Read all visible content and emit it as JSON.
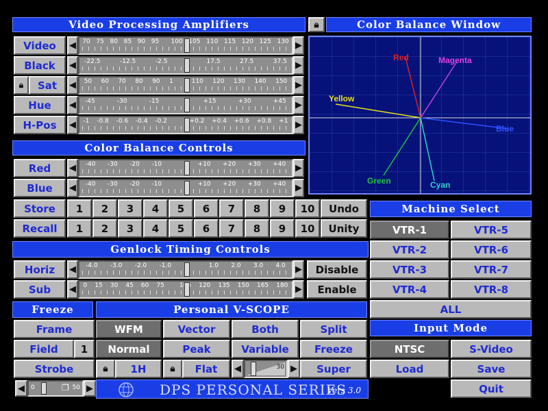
{
  "vpa": {
    "title": "Video Processing Amplifiers",
    "rows": [
      {
        "label": "Video",
        "ticks": [
          "70",
          "75",
          "80",
          "85",
          "90",
          "95",
          "",
          "100",
          "105",
          "110",
          "115",
          "120",
          "125",
          "130"
        ]
      },
      {
        "label": "Black",
        "ticks": [
          "-22.5",
          "",
          "-12.5",
          "",
          "-2.5",
          "",
          "",
          "",
          "17.5",
          "",
          "27.5",
          "",
          "37.5"
        ]
      },
      {
        "label": "Sat",
        "ticks": [
          "50",
          "60",
          "70",
          "80",
          "90",
          "1",
          "",
          "110",
          "120",
          "130",
          "140",
          "150"
        ]
      },
      {
        "label": "Hue",
        "ticks": [
          "-45",
          "",
          "-30",
          "",
          "-15",
          "",
          "",
          "",
          "+15",
          "",
          "+30",
          "",
          "+45"
        ]
      },
      {
        "label": "H-Pos",
        "ticks": [
          "-1",
          "-0.8",
          "-0.6",
          "-0.4",
          "-0.2",
          "",
          "",
          "+0.2",
          "+0.4",
          "+0.6",
          "+0.8",
          "+1"
        ]
      }
    ]
  },
  "cb_window": {
    "title": "Color Balance Window",
    "vectors": [
      {
        "name": "Red",
        "color": "#e02020"
      },
      {
        "name": "Magenta",
        "color": "#e040e0"
      },
      {
        "name": "Yellow",
        "color": "#e8e020"
      },
      {
        "name": "Blue",
        "color": "#3050ff"
      },
      {
        "name": "Green",
        "color": "#20c040"
      },
      {
        "name": "Cyan",
        "color": "#30d0d0"
      }
    ]
  },
  "cbc": {
    "title": "Color Balance Controls",
    "rows": [
      {
        "label": "Red",
        "ticks": [
          "-40",
          "-30",
          "-20",
          "-10",
          "",
          "",
          "+10",
          "+20",
          "+30",
          "+40"
        ]
      },
      {
        "label": "Blue",
        "ticks": [
          "-40",
          "-30",
          "-20",
          "-10",
          "",
          "",
          "+10",
          "+20",
          "+30",
          "+40"
        ]
      }
    ]
  },
  "store": {
    "label": "Store",
    "numbers": [
      "1",
      "2",
      "3",
      "4",
      "5",
      "6",
      "7",
      "8",
      "9",
      "10"
    ],
    "extra": "Undo"
  },
  "recall": {
    "label": "Recall",
    "numbers": [
      "1",
      "2",
      "3",
      "4",
      "5",
      "6",
      "7",
      "8",
      "9",
      "10"
    ],
    "extra": "Unity"
  },
  "machine": {
    "title": "Machine Select",
    "items": [
      "VTR-1",
      "VTR-5",
      "VTR-2",
      "VTR-6",
      "VTR-3",
      "VTR-7",
      "VTR-4",
      "VTR-8"
    ],
    "all": "ALL"
  },
  "genlock": {
    "title": "Genlock Timing Controls",
    "rows": [
      {
        "label": "Horiz",
        "ticks": [
          "-4.0",
          "-3.0",
          "-2.0",
          "-1.0",
          "",
          "",
          "1.0",
          "2.0",
          "3.0",
          "4.0"
        ],
        "action": "Disable"
      },
      {
        "label": "Sub",
        "ticks": [
          "0",
          "15",
          "30",
          "45",
          "60",
          "75",
          "",
          "105",
          "120",
          "135",
          "150",
          "165",
          "180"
        ],
        "action": "Enable"
      }
    ]
  },
  "freeze_label": "Freeze",
  "vscope": {
    "title": "Personal V-SCOPE",
    "row1": [
      "WFM",
      "Vector",
      "Both",
      "Split"
    ],
    "row2": [
      "Normal",
      "Peak",
      "Variable",
      "Freeze"
    ],
    "super": "Super",
    "h1": "1H",
    "flat": "Flat",
    "mini_value": "30"
  },
  "left": {
    "frame": "Frame",
    "field": "Field",
    "field_num": "1",
    "strobe": "Strobe",
    "mini0": "0",
    "mini50": "50"
  },
  "input": {
    "title": "Input Mode",
    "ntsc": "NTSC",
    "svideo": "S-Video",
    "load": "Load",
    "save": "Save",
    "quit": "Quit"
  },
  "footer": {
    "brand": "DPS PERSONAL SERIES",
    "version": "Vers 3.0"
  }
}
